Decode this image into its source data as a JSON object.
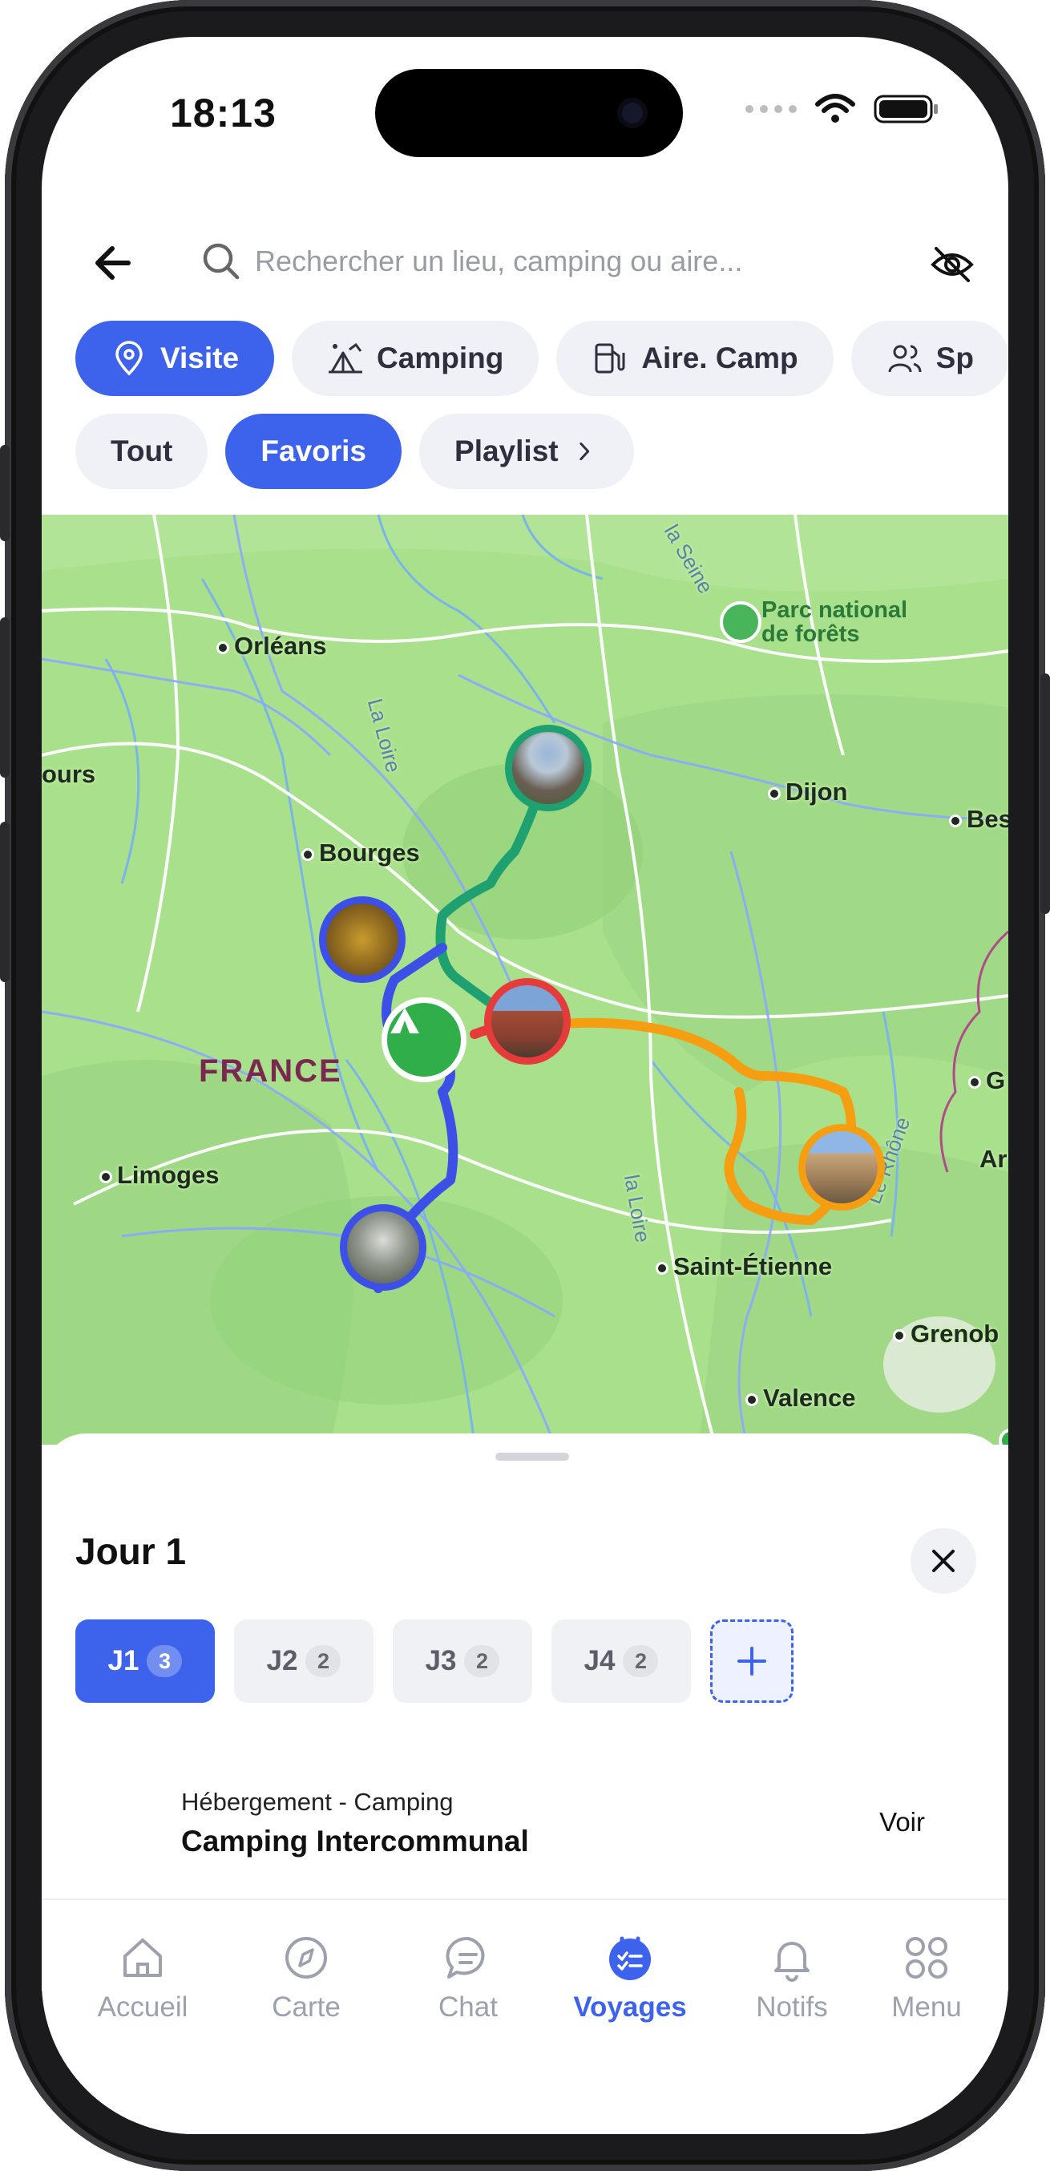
{
  "status_bar": {
    "time": "18:13"
  },
  "search": {
    "placeholder": "Rechercher un lieu, camping ou aire..."
  },
  "categories": [
    {
      "label": "Visite",
      "icon": "location-pin-icon",
      "active": true
    },
    {
      "label": "Camping",
      "icon": "camping-tent-icon",
      "active": false
    },
    {
      "label": "Aire. Camp",
      "icon": "fuel-station-icon",
      "active": false
    },
    {
      "label": "Sp",
      "icon": "people-icon",
      "active": false
    }
  ],
  "filters": [
    {
      "label": "Tout",
      "active": false
    },
    {
      "label": "Favoris",
      "active": true
    },
    {
      "label": "Playlist",
      "active": false,
      "icon": "chevron-right-icon"
    }
  ],
  "map": {
    "cities": [
      "Orléans",
      "ours",
      "Bourges",
      "Dijon",
      "Bes",
      "Limoges",
      "Saint-Étienne",
      "Grenob",
      "Valence",
      "G",
      "Ar"
    ],
    "rivers": [
      "la Seine",
      "La Loire",
      "la Loire",
      "Le Rhône"
    ],
    "country": "FRANCE",
    "park": {
      "line1": "Parc national",
      "line2": "de forêts"
    },
    "route_colors": {
      "green": "#1fa070",
      "blue": "#3c4fe6",
      "orange": "#f59e12",
      "red": "#e53b3b",
      "camp": "#2fae4a"
    }
  },
  "sheet": {
    "title": "Jour 1",
    "days": [
      {
        "label": "J1",
        "count": "3",
        "active": true
      },
      {
        "label": "J2",
        "count": "2",
        "active": false
      },
      {
        "label": "J3",
        "count": "2",
        "active": false
      },
      {
        "label": "J4",
        "count": "2",
        "active": false
      }
    ],
    "lodging": {
      "category": "Hébergement - Camping",
      "name": "Camping Intercommunal",
      "action": "Voir"
    }
  },
  "tabbar": [
    {
      "label": "Accueil",
      "icon": "home-icon",
      "active": false
    },
    {
      "label": "Carte",
      "icon": "compass-icon",
      "active": false
    },
    {
      "label": "Chat",
      "icon": "chat-bubble-icon",
      "active": false
    },
    {
      "label": "Voyages",
      "icon": "checklist-icon",
      "active": true
    },
    {
      "label": "Notifs",
      "icon": "bell-icon",
      "active": false
    },
    {
      "label": "Menu",
      "icon": "grid-menu-icon",
      "active": false
    }
  ],
  "colors": {
    "accent": "#3d63ec",
    "map_bg": "#a7e08a"
  }
}
